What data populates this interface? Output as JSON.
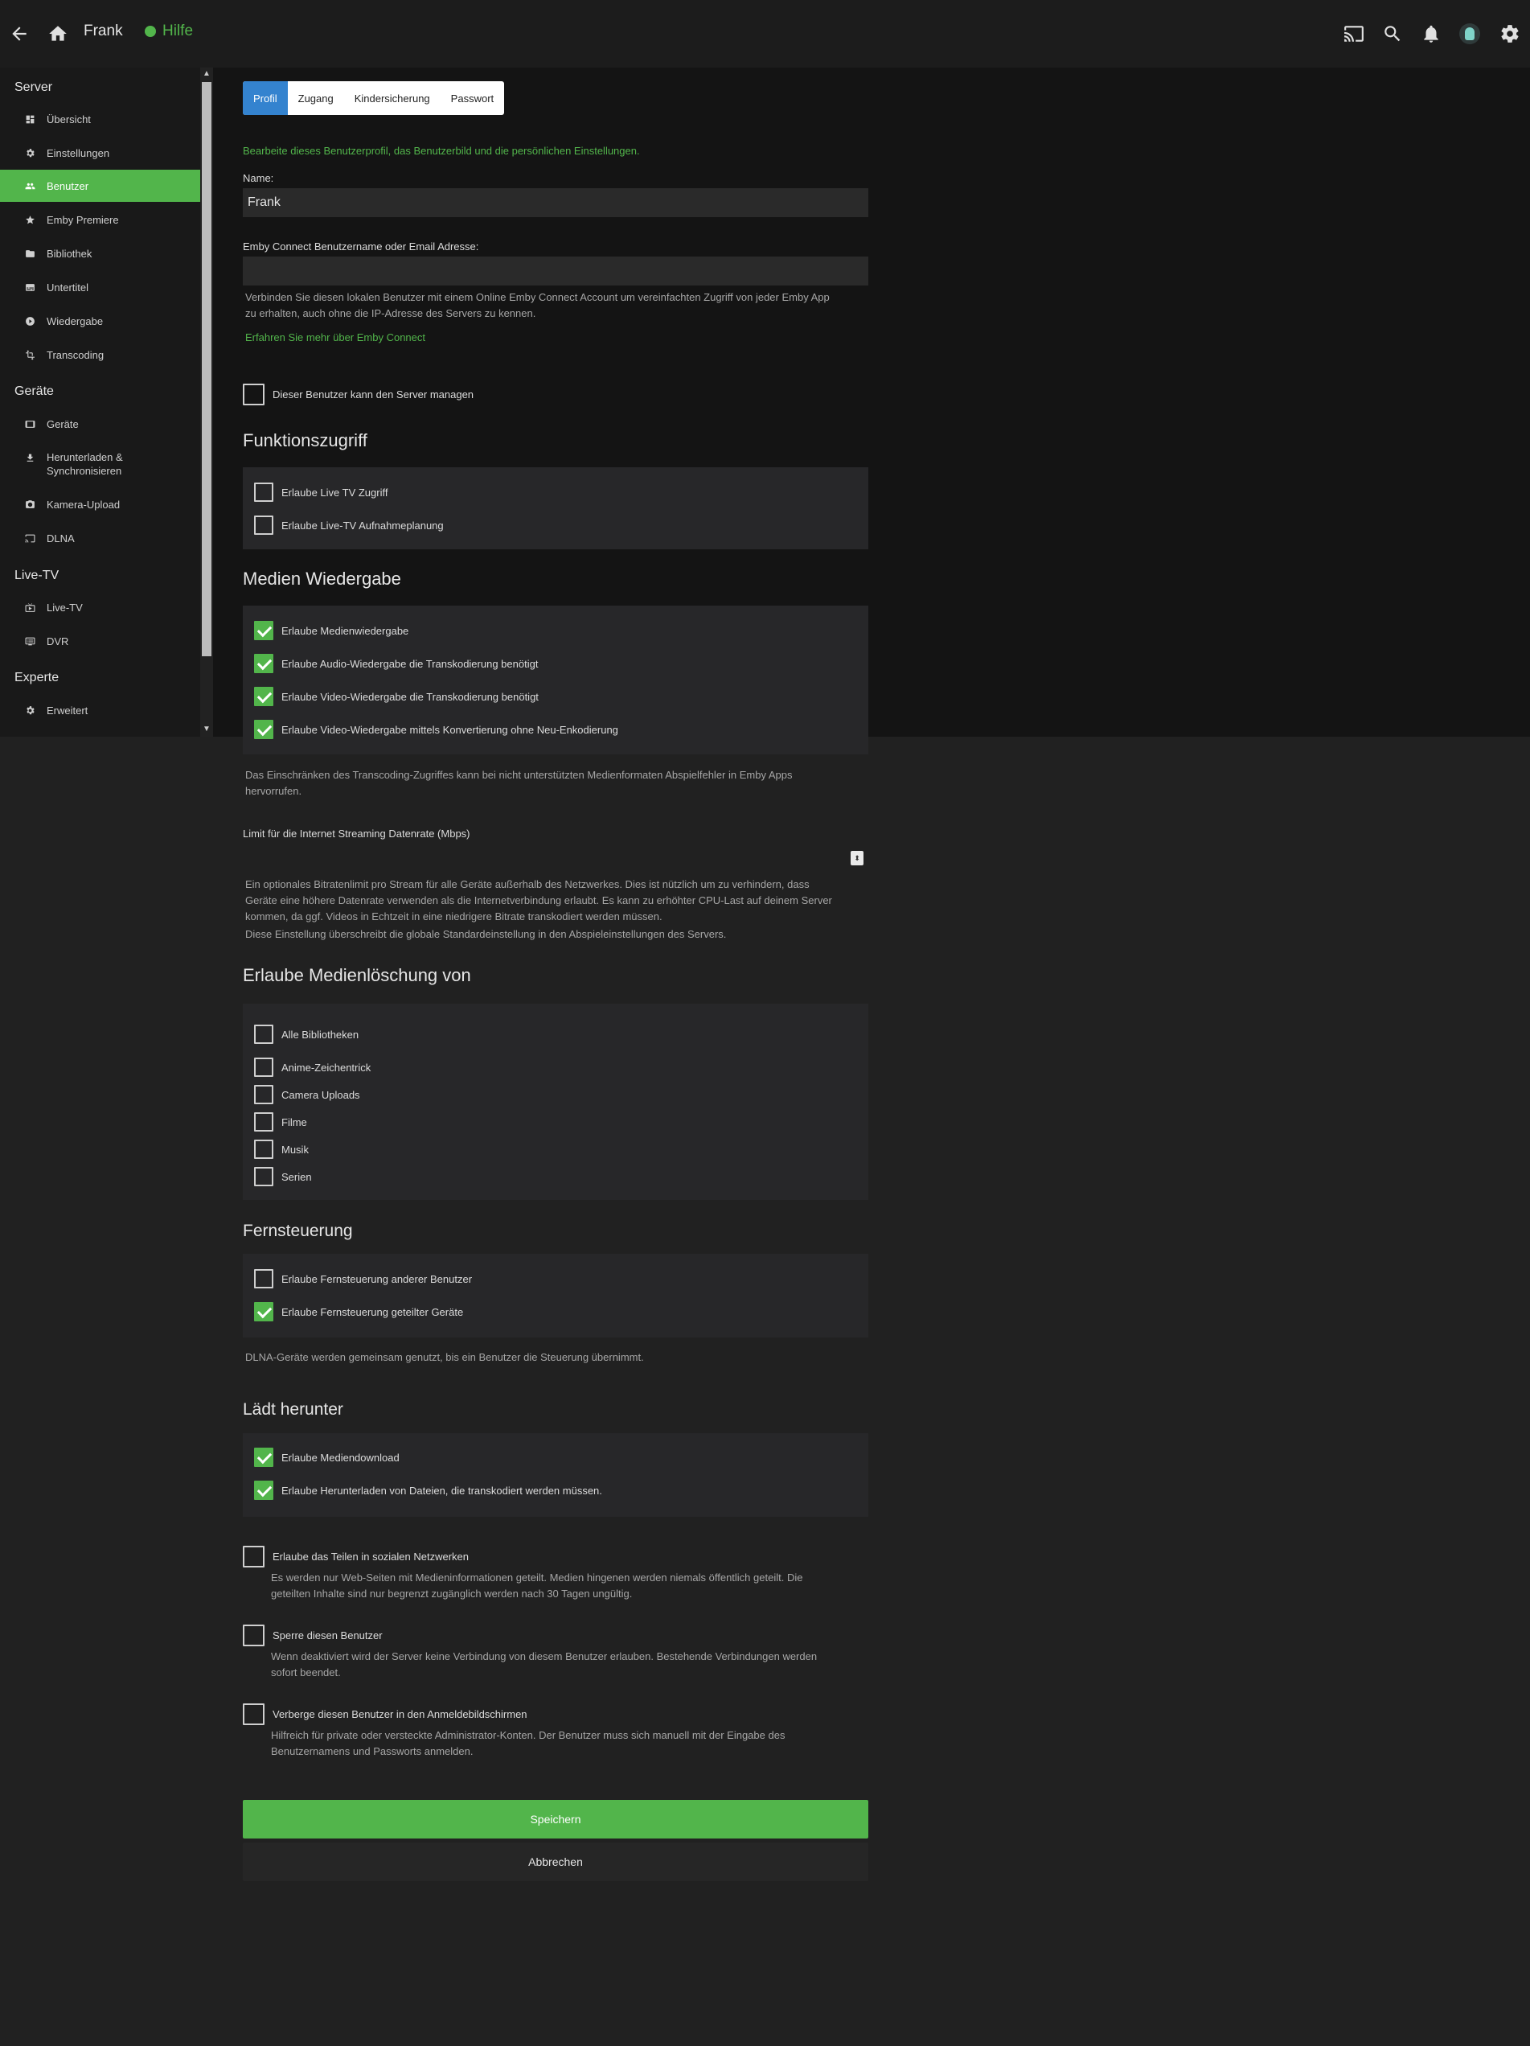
{
  "header": {
    "title": "Frank",
    "help_label": "Hilfe"
  },
  "sidebar": {
    "sections": [
      {
        "title": "Server"
      },
      {
        "title": "Geräte"
      },
      {
        "title": "Live-TV"
      },
      {
        "title": "Experte"
      }
    ],
    "items": [
      {
        "label": "Übersicht",
        "icon": "dashboard-icon"
      },
      {
        "label": "Einstellungen",
        "icon": "gear-icon"
      },
      {
        "label": "Benutzer",
        "icon": "people-icon",
        "active": true
      },
      {
        "label": "Emby Premiere",
        "icon": "star-icon"
      },
      {
        "label": "Bibliothek",
        "icon": "folder-icon"
      },
      {
        "label": "Untertitel",
        "icon": "subtitles-icon"
      },
      {
        "label": "Wiedergabe",
        "icon": "play-circle-icon"
      },
      {
        "label": "Transcoding",
        "icon": "transform-icon"
      },
      {
        "label": "Geräte",
        "icon": "tablet-icon"
      },
      {
        "label": "Herunterladen &",
        "label2": "Synchronisieren",
        "icon": "download-icon"
      },
      {
        "label": "Kamera-Upload",
        "icon": "camera-icon"
      },
      {
        "label": "DLNA",
        "icon": "cast-connected-icon"
      },
      {
        "label": "Live-TV",
        "icon": "live-tv-icon"
      },
      {
        "label": "DVR",
        "icon": "dvr-icon"
      },
      {
        "label": "Erweitert",
        "icon": "gear-icon"
      }
    ]
  },
  "tabs": [
    {
      "label": "Profil",
      "active": true
    },
    {
      "label": "Zugang"
    },
    {
      "label": "Kindersicherung"
    },
    {
      "label": "Passwort"
    }
  ],
  "profile": {
    "intro": "Bearbeite dieses Benutzerprofil, das Benutzerbild und die persönlichen Einstellungen.",
    "name_label": "Name:",
    "name_value": "Frank",
    "connect_label": "Emby Connect Benutzername oder Email Adresse:",
    "connect_value": "",
    "connect_help_1": "Verbinden Sie diesen lokalen Benutzer mit einem Online Emby Connect Account um vereinfachten Zugriff von jeder Emby App",
    "connect_help_2": "zu erhalten, auch ohne die IP-Adresse des Servers zu kennen.",
    "connect_link": "Erfahren Sie mehr über Emby Connect",
    "admin_label": "Dieser Benutzer kann den Server managen"
  },
  "feature_access": {
    "title": "Funktionszugriff",
    "items": [
      {
        "label": "Erlaube Live TV Zugriff",
        "checked": false
      },
      {
        "label": "Erlaube Live-TV Aufnahmeplanung",
        "checked": false
      }
    ]
  },
  "media_playback": {
    "title": "Medien Wiedergabe",
    "items": [
      {
        "label": "Erlaube Medienwiedergabe",
        "checked": true
      },
      {
        "label": "Erlaube Audio-Wiedergabe die Transkodierung benötigt",
        "checked": true
      },
      {
        "label": "Erlaube Video-Wiedergabe die Transkodierung benötigt",
        "checked": true
      },
      {
        "label": "Erlaube Video-Wiedergabe mittels Konvertierung ohne Neu-Enkodierung",
        "checked": true
      }
    ],
    "help_1": "Das Einschränken des Transcoding-Zugriffes kann bei nicht unterstützten Medienformaten Abspielfehler in Emby Apps",
    "help_2": "hervorrufen.",
    "bitrate_label": "Limit für die Internet Streaming Datenrate (Mbps)",
    "bitrate_value": "",
    "bitrate_help_1": "Ein optionales Bitratenlimit pro Stream für alle Geräte außerhalb des Netzwerkes. Dies ist nützlich um zu verhindern, dass",
    "bitrate_help_2": "Geräte eine höhere Datenrate verwenden als die Internetverbindung erlaubt. Es kann zu erhöhter CPU-Last auf deinem Server",
    "bitrate_help_3": "kommen, da ggf. Videos in Echtzeit in eine niedrigere Bitrate transkodiert werden müssen.",
    "bitrate_help_4": "Diese Einstellung überschreibt die globale Standardeinstellung in den Abspieleinstellungen des Servers."
  },
  "media_deletion": {
    "title": "Erlaube Medienlöschung von",
    "items": [
      {
        "label": "Alle Bibliotheken",
        "checked": false
      },
      {
        "label": "Anime-Zeichentrick",
        "checked": false
      },
      {
        "label": "Camera Uploads",
        "checked": false
      },
      {
        "label": "Filme",
        "checked": false
      },
      {
        "label": "Musik",
        "checked": false
      },
      {
        "label": "Serien",
        "checked": false
      }
    ]
  },
  "remote_control": {
    "title": "Fernsteuerung",
    "items": [
      {
        "label": "Erlaube Fernsteuerung anderer Benutzer",
        "checked": false
      },
      {
        "label": "Erlaube Fernsteuerung geteilter Geräte",
        "checked": true
      }
    ],
    "help": "DLNA-Geräte werden gemeinsam genutzt, bis ein Benutzer die Steuerung übernimmt."
  },
  "downloads": {
    "title": "Lädt herunter",
    "items": [
      {
        "label": "Erlaube Mediendownload",
        "checked": true
      },
      {
        "label": "Erlaube Herunterladen von Dateien, die transkodiert werden müssen.",
        "checked": true
      }
    ]
  },
  "misc": [
    {
      "label": "Erlaube das Teilen in sozialen Netzwerken",
      "checked": false,
      "help_1": "Es werden nur Web-Seiten mit Medieninformationen geteilt. Medien hingenen werden niemals öffentlich geteilt. Die",
      "help_2": "geteilten Inhalte sind nur begrenzt zugänglich werden nach 30 Tagen ungültig."
    },
    {
      "label": "Sperre diesen Benutzer",
      "checked": false,
      "help_1": "Wenn deaktiviert wird der Server keine Verbindung von diesem Benutzer erlauben. Bestehende Verbindungen werden",
      "help_2": "sofort beendet."
    },
    {
      "label": "Verberge diesen Benutzer in den Anmeldebildschirmen",
      "checked": false,
      "help_1": "Hilfreich für private oder versteckte Administrator-Konten. Der Benutzer muss sich manuell mit der Eingabe des",
      "help_2": "Benutzernamens und Passworts anmelden."
    }
  ],
  "actions": {
    "save_label": "Speichern",
    "cancel_label": "Abbrechen"
  },
  "colors": {
    "accent": "#52b54b",
    "tab_active": "#3483cf"
  }
}
